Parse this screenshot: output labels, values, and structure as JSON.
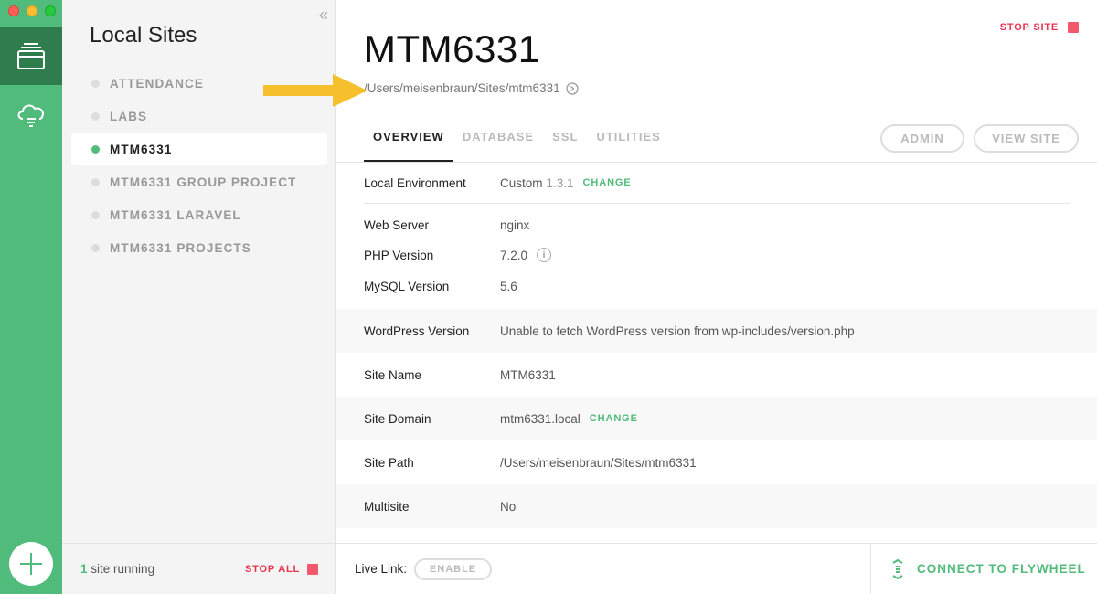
{
  "sidebar": {
    "title": "Local Sites",
    "collapse_glyph": "«",
    "sites": [
      {
        "name": "ATTENDANCE",
        "selected": false
      },
      {
        "name": "LABS",
        "selected": false
      },
      {
        "name": "MTM6331",
        "selected": true
      },
      {
        "name": "MTM6331 GROUP PROJECT",
        "selected": false
      },
      {
        "name": "MTM6331 LARAVEL",
        "selected": false
      },
      {
        "name": "MTM6331 PROJECTS",
        "selected": false
      }
    ],
    "footer": {
      "running_count": "1",
      "running_text": "site running",
      "stop_all": "STOP ALL"
    }
  },
  "site": {
    "title": "MTM6331",
    "path": "/Users/meisenbraun/Sites/mtm6331",
    "stop_site": "STOP SITE"
  },
  "tabs": [
    "OVERVIEW",
    "DATABASE",
    "SSL",
    "UTILITIES"
  ],
  "buttons": {
    "admin": "ADMIN",
    "view_site": "VIEW SITE"
  },
  "overview": {
    "local_environment": {
      "label": "Local Environment",
      "value": "Custom",
      "version": "1.3.1",
      "action": "CHANGE"
    },
    "web_server": {
      "label": "Web Server",
      "value": "nginx"
    },
    "php_version": {
      "label": "PHP Version",
      "value": "7.2.0",
      "info_glyph": "i"
    },
    "mysql_version": {
      "label": "MySQL Version",
      "value": "5.6"
    },
    "wordpress_version": {
      "label": "WordPress Version",
      "value": "Unable to fetch WordPress version from wp-includes/version.php"
    },
    "site_name": {
      "label": "Site Name",
      "value": "MTM6331"
    },
    "site_domain": {
      "label": "Site Domain",
      "value": "mtm6331.local",
      "action": "CHANGE"
    },
    "site_path": {
      "label": "Site Path",
      "value": "/Users/meisenbraun/Sites/mtm6331"
    },
    "multisite": {
      "label": "Multisite",
      "value": "No"
    }
  },
  "footer": {
    "live_link_label": "Live Link:",
    "enable": "ENABLE",
    "connect": "CONNECT TO FLYWHEEL"
  },
  "colors": {
    "accent": "#51bb7b",
    "rail_active": "#2f7d4d",
    "stop": "#e8344f",
    "annotation_arrow": "#f5c02c"
  },
  "icons": [
    "sites-icon",
    "cloud-icon",
    "plus-icon",
    "open-folder-icon",
    "info-icon",
    "flywheel-icon",
    "stop-icon"
  ]
}
